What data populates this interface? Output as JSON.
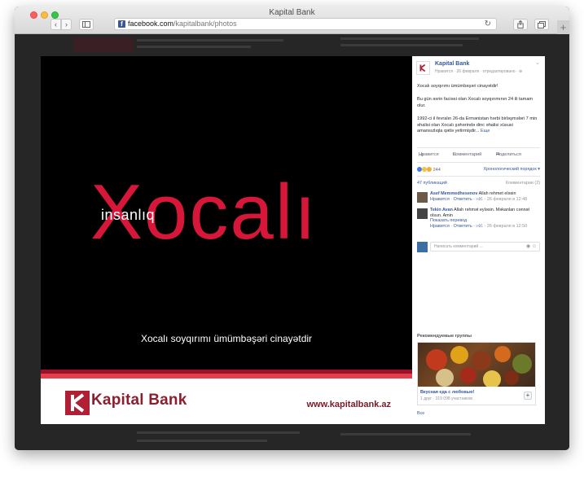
{
  "window": {
    "title": "Kapital Bank"
  },
  "toolbar": {
    "back_icon": "chevron-left-icon",
    "forward_icon": "chevron-right-icon",
    "url_domain": "facebook.com",
    "url_path": "/kapitalbank/photos",
    "new_tab_label": "+"
  },
  "photo": {
    "word_top": "insanlıq",
    "word_main": "Xocalı",
    "caption": "Xocalı soyqırımı ümümbəşəri cinayətdir",
    "brand_name": "Kapital Bank",
    "brand_site": "www.kapitalbank.az",
    "colors": {
      "accent_red": "#d6173a",
      "brand_dark": "#8b1f2f"
    }
  },
  "post": {
    "page_name": "Kapital Bank",
    "meta": "Нравится · 26 февраля · отредактировано · ⊕",
    "text_1": "Xocalı soyqırımı ümümbəşəri cinayətdir!",
    "text_2": "Bu gün əsrin faciəsi olan Xocalı soyqırımının 24 ili tamam olur.",
    "text_3": "1992-ci il fevralın 26-da Ermənistan hərbi birləşmələri 7 min əhalisi olan Xocalı şəhərində dinc əhalisi xüsusi amansızlıqla qətlə yetirmişdir...",
    "more_label": "Еще",
    "actions": {
      "like": "Нравится",
      "comment": "Комментарий",
      "share": "Поделиться"
    },
    "reaction_count": "244",
    "sort_label": "Хронологический порядок",
    "publications": "47 публикаций",
    "comments_count": "Комментарии (2)",
    "comments": [
      {
        "author": "Asef Memmedhesenov",
        "text": "Allah rehmet eləsin",
        "like": "Нравится",
        "reply": "Ответить",
        "likes": "1",
        "time": "26 февраля в 12:48"
      },
      {
        "author": "Tekin Avan",
        "text": "Allah rəhmət eyləsin. Məkanları cənnət olsun. Amin",
        "show_translation": "Показать перевод",
        "like": "Нравится",
        "reply": "Ответить",
        "likes": "1",
        "time": "26 февраля в 12:50"
      }
    ],
    "comment_placeholder": "Написать комментарий ...",
    "recommended": {
      "title": "Рекомендуемые группы",
      "group_name": "Вкусная еда с любовью!",
      "group_sub": "1 друг · 319 098 участников",
      "join_label": "+",
      "all_label": "Все"
    }
  }
}
